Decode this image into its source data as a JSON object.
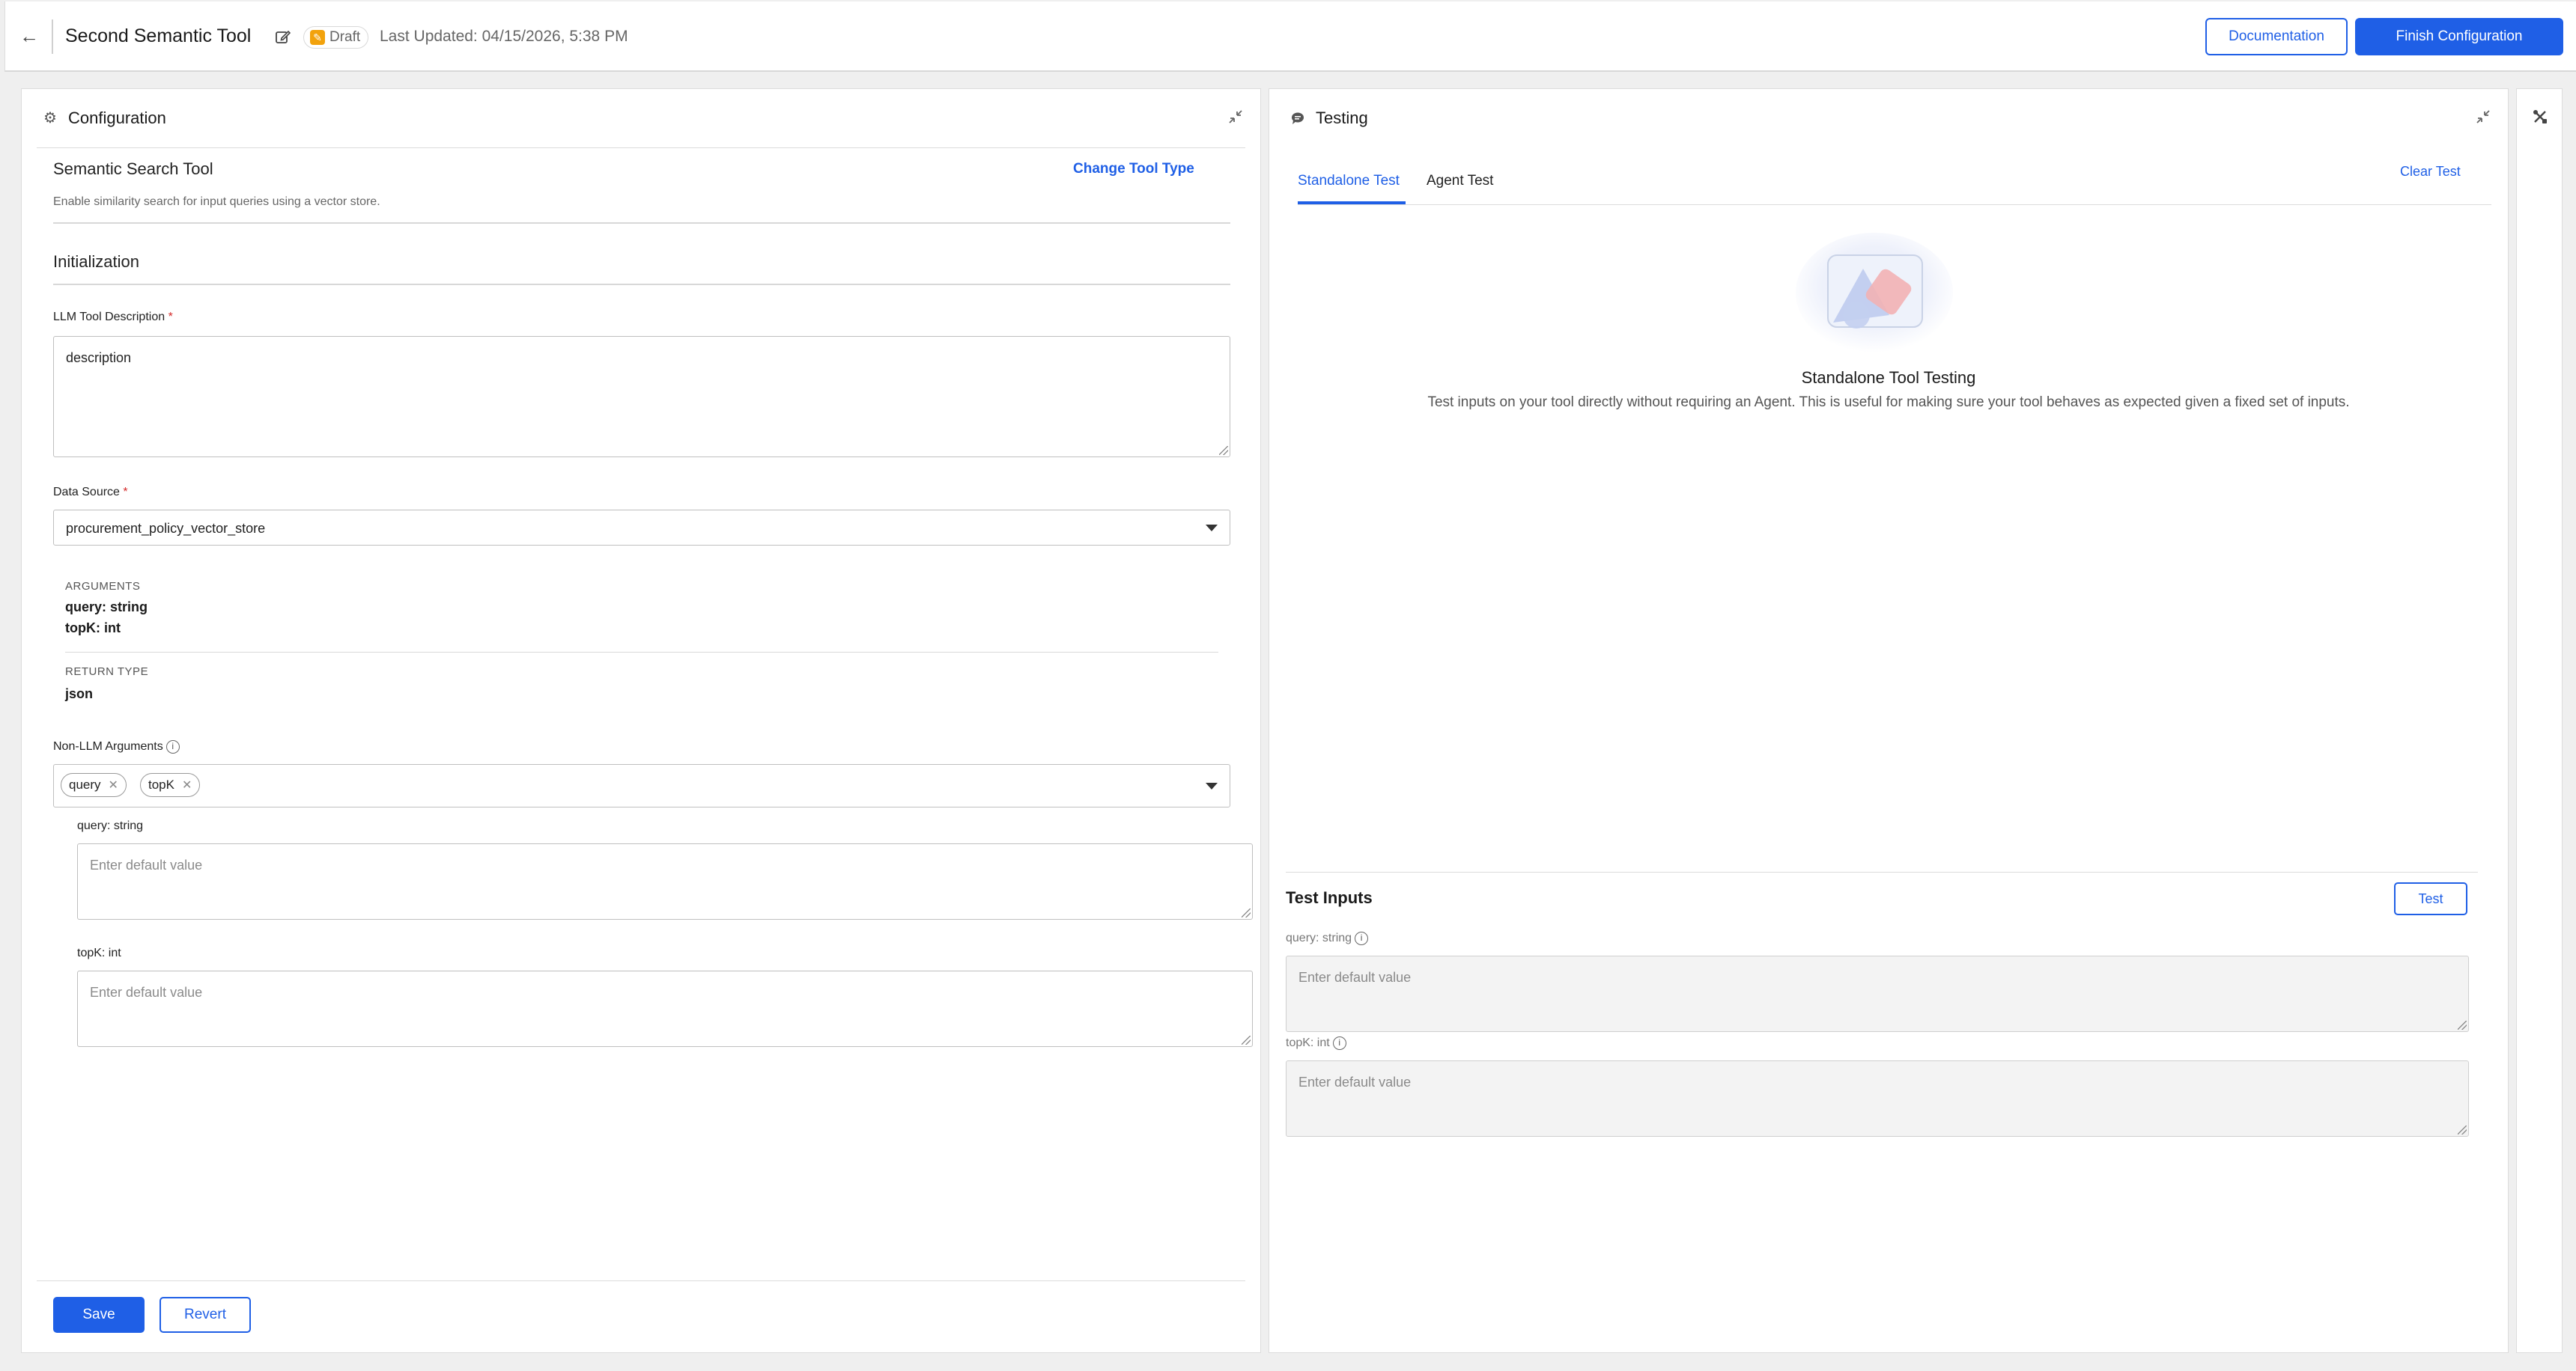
{
  "header": {
    "title": "Second Semantic Tool",
    "draft_label": "Draft",
    "last_updated": "Last Updated: 04/15/2026, 5:38 PM",
    "documentation_label": "Documentation",
    "finish_label": "Finish Configuration"
  },
  "config": {
    "panel_title": "Configuration",
    "tool_title": "Semantic Search Tool",
    "change_tool_type": "Change Tool Type",
    "tool_desc": "Enable similarity search for input queries using a vector store.",
    "section_title": "Initialization",
    "llm_desc_label": "LLM Tool Description",
    "llm_desc_value": "description",
    "data_source_label": "Data Source",
    "data_source_value": "procurement_policy_vector_store",
    "arguments_label": "ARGUMENTS",
    "arguments": [
      "query: string",
      "topK: int"
    ],
    "return_type_label": "RETURN TYPE",
    "return_type_value": "json",
    "non_llm_label": "Non-LLM Arguments",
    "chips": [
      "query",
      "topK"
    ],
    "query_field_label": "query: string",
    "query_placeholder": "Enter default value",
    "topk_field_label": "topK: int",
    "topk_placeholder": "Enter default value",
    "save_label": "Save",
    "revert_label": "Revert"
  },
  "testing": {
    "panel_title": "Testing",
    "tabs": [
      "Standalone Test",
      "Agent Test"
    ],
    "clear_label": "Clear Test",
    "empty_title": "Standalone Tool Testing",
    "empty_desc": "Test inputs on your tool directly without requiring an Agent. This is useful for making sure your tool behaves as expected given a fixed set of inputs.",
    "inputs_title": "Test Inputs",
    "test_button": "Test",
    "query_label": "query: string",
    "query_placeholder": "Enter default value",
    "topk_label": "topK: int",
    "topk_placeholder": "Enter default value"
  },
  "colors": {
    "accent": "#1f5fe6",
    "draft": "#f2a20c",
    "required": "#d42a2a"
  },
  "icons": [
    "back-arrow-icon",
    "edit-icon",
    "draft-icon",
    "gear-icon",
    "collapse-icon",
    "chat-icon",
    "tools-icon",
    "info-icon",
    "chevron-down-icon",
    "close-icon"
  ]
}
